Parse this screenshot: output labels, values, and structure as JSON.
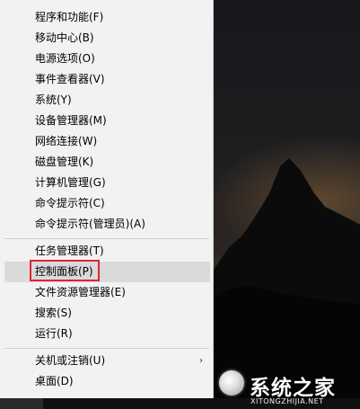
{
  "menu": {
    "items": [
      {
        "label": "程序和功能(F)"
      },
      {
        "label": "移动中心(B)"
      },
      {
        "label": "电源选项(O)"
      },
      {
        "label": "事件查看器(V)"
      },
      {
        "label": "系统(Y)"
      },
      {
        "label": "设备管理器(M)"
      },
      {
        "label": "网络连接(W)"
      },
      {
        "label": "磁盘管理(K)"
      },
      {
        "label": "计算机管理(G)"
      },
      {
        "label": "命令提示符(C)"
      },
      {
        "label": "命令提示符(管理员)(A)"
      },
      {
        "label": "任务管理器(T)"
      },
      {
        "label": "控制面板(P)"
      },
      {
        "label": "文件资源管理器(E)"
      },
      {
        "label": "搜索(S)"
      },
      {
        "label": "运行(R)"
      },
      {
        "label": "关机或注销(U)"
      },
      {
        "label": "桌面(D)"
      }
    ],
    "highlighted_item": "控制面板(P)",
    "submenu_arrow_glyph": "›",
    "highlight_box_color": "#e0262f"
  },
  "watermark": {
    "brand_cn": "系统之家",
    "brand_en": "XITONGZHIJIA.NET"
  }
}
